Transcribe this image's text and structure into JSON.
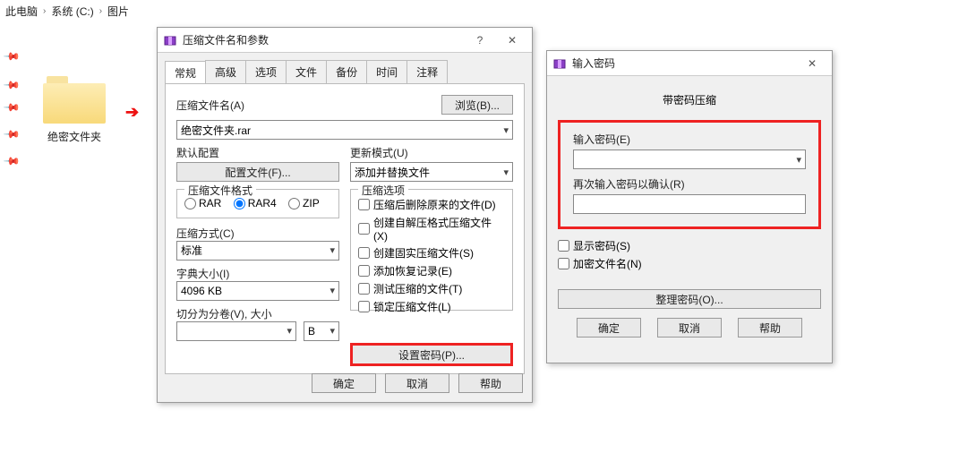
{
  "breadcrumb": {
    "this_pc": "此电脑",
    "drive": "系统 (C:)",
    "folder": "图片"
  },
  "desktop_folder": {
    "name": "绝密文件夹"
  },
  "archive_dialog": {
    "title": "压缩文件名和参数",
    "tabs": [
      "常规",
      "高级",
      "选项",
      "文件",
      "备份",
      "时间",
      "注释"
    ],
    "archive_name_label": "压缩文件名(A)",
    "browse_btn": "浏览(B)...",
    "archive_name": "绝密文件夹.rar",
    "default_profile_label": "默认配置",
    "profile_btn": "配置文件(F)...",
    "update_mode_label": "更新模式(U)",
    "update_mode_value": "添加并替换文件",
    "format_label": "压缩文件格式",
    "formats": [
      "RAR",
      "RAR4",
      "ZIP"
    ],
    "format_selected": "RAR4",
    "method_label": "压缩方式(C)",
    "method_value": "标准",
    "dict_label": "字典大小(I)",
    "dict_value": "4096 KB",
    "split_label": "切分为分卷(V), 大小",
    "split_value": "",
    "split_unit": "B",
    "options_label": "压缩选项",
    "checkboxes": [
      "压缩后删除原来的文件(D)",
      "创建自解压格式压缩文件(X)",
      "创建固实压缩文件(S)",
      "添加恢复记录(E)",
      "测试压缩的文件(T)",
      "锁定压缩文件(L)"
    ],
    "set_password_btn": "设置密码(P)...",
    "ok": "确定",
    "cancel": "取消",
    "help": "帮助"
  },
  "password_dialog": {
    "title": "输入密码",
    "subtitle": "带密码压缩",
    "enter_pwd_label": "输入密码(E)",
    "pwd_value": "",
    "reenter_label": "再次输入密码以确认(R)",
    "reenter_value": "",
    "show_pwd": "显示密码(S)",
    "encrypt_names": "加密文件名(N)",
    "organize_btn": "整理密码(O)...",
    "ok": "确定",
    "cancel": "取消",
    "help": "帮助"
  }
}
